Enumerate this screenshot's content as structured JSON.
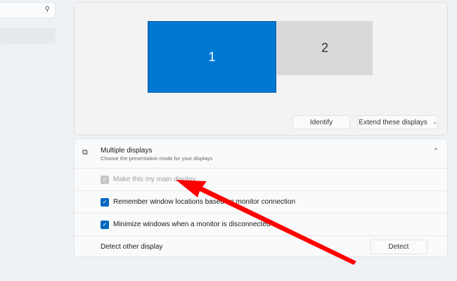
{
  "search": {
    "icon": "search-icon"
  },
  "display": {
    "monitor1": "1",
    "monitor2": "2",
    "identify": "Identify",
    "mode": "Extend these displays"
  },
  "multiple": {
    "title": "Multiple displays",
    "subtitle": "Choose the presentation mode for your displays",
    "options": [
      {
        "label": "Make this my main display",
        "checked": true,
        "disabled": true
      },
      {
        "label": "Remember window locations based on monitor connection",
        "checked": true,
        "disabled": false
      },
      {
        "label": "Minimize windows when a monitor is disconnected",
        "checked": true,
        "disabled": false
      }
    ],
    "detect_label": "Detect other display",
    "detect_button": "Detect"
  },
  "colors": {
    "accent": "#0078d4",
    "arrow": "#ff0000"
  }
}
